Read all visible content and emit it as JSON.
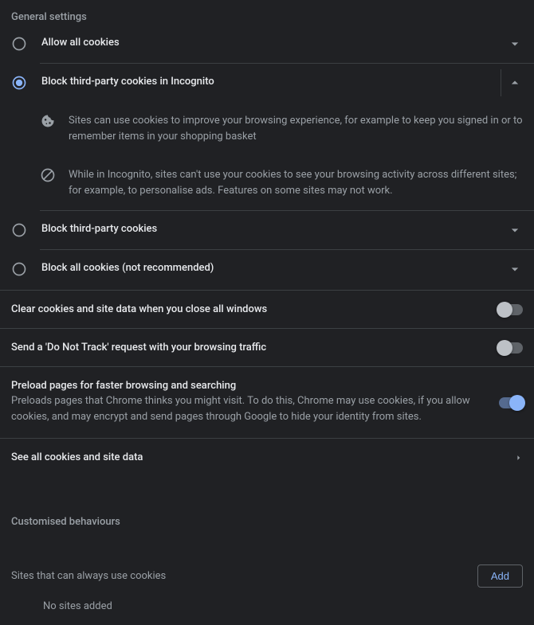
{
  "sectionGeneral": "General settings",
  "options": {
    "allowAll": "Allow all cookies",
    "blockIncognito": "Block third-party cookies in Incognito",
    "blockThird": "Block third-party cookies",
    "blockAll": "Block all cookies (not recommended)"
  },
  "details": {
    "cookie": "Sites can use cookies to improve your browsing experience, for example to keep you signed in or to remember items in your shopping basket",
    "incognito": "While in Incognito, sites can't use your cookies to see your browsing activity across different sites; for example, to personalise ads. Features on some sites may not work."
  },
  "toggles": {
    "clearOnExit": {
      "title": "Clear cookies and site data when you close all windows"
    },
    "dnt": {
      "title": "Send a 'Do Not Track' request with your browsing traffic"
    },
    "preload": {
      "title": "Preload pages for faster browsing and searching",
      "desc": "Preloads pages that Chrome thinks you might visit. To do this, Chrome may use cookies, if you allow cookies, and may encrypt and send pages through Google to hide your identity from sites."
    }
  },
  "link": {
    "seeAll": "See all cookies and site data"
  },
  "sectionCustom": "Customised behaviours",
  "behaviors": {
    "alwaysUse": {
      "title": "Sites that can always use cookies",
      "addBtn": "Add",
      "empty": "No sites added"
    }
  },
  "colors": {
    "accent": "#8ab4f8"
  }
}
